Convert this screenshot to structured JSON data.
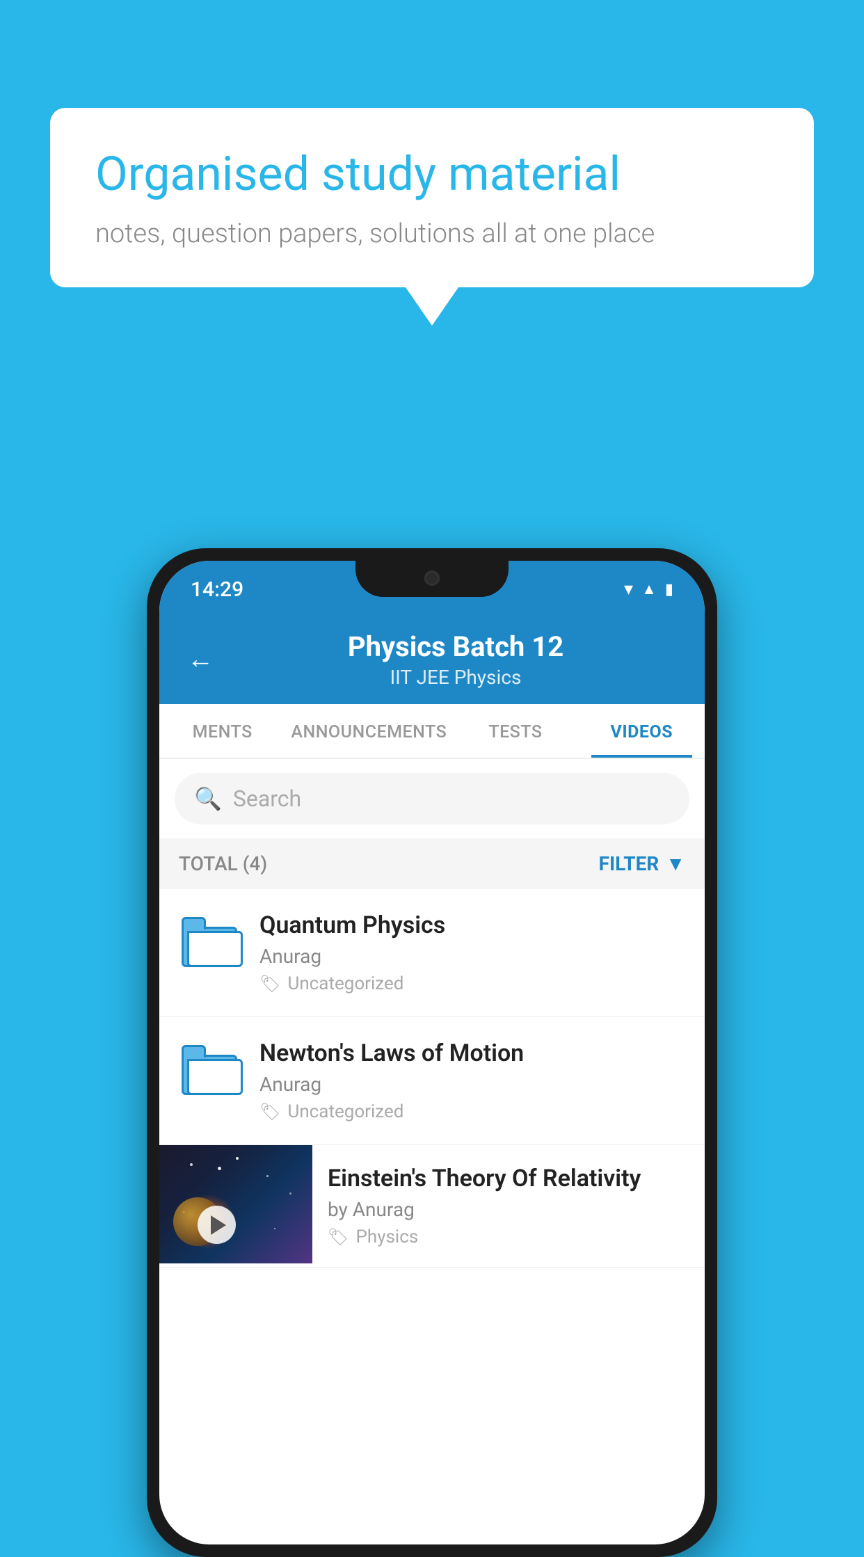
{
  "background_color": "#29b6e8",
  "speech_bubble": {
    "title": "Organised study material",
    "subtitle": "notes, question papers, solutions all at one place"
  },
  "status_bar": {
    "time": "14:29",
    "icons": [
      "wifi",
      "signal",
      "battery"
    ]
  },
  "header": {
    "back_label": "←",
    "title": "Physics Batch 12",
    "subtitle": "IIT JEE   Physics"
  },
  "tabs": [
    {
      "label": "MENTS",
      "active": false
    },
    {
      "label": "ANNOUNCEMENTS",
      "active": false
    },
    {
      "label": "TESTS",
      "active": false
    },
    {
      "label": "VIDEOS",
      "active": true
    }
  ],
  "search": {
    "placeholder": "Search"
  },
  "filter": {
    "total_label": "TOTAL (4)",
    "filter_label": "FILTER"
  },
  "videos": [
    {
      "title": "Quantum Physics",
      "author": "Anurag",
      "tag": "Uncategorized",
      "has_thumbnail": false
    },
    {
      "title": "Newton's Laws of Motion",
      "author": "Anurag",
      "tag": "Uncategorized",
      "has_thumbnail": false
    },
    {
      "title": "Einstein's Theory Of Relativity",
      "author": "by Anurag",
      "tag": "Physics",
      "has_thumbnail": true
    }
  ]
}
